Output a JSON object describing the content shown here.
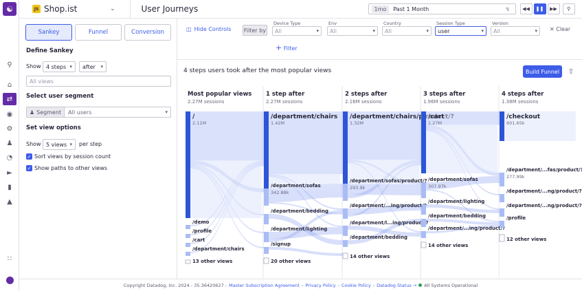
{
  "nav": {
    "logo_icon": "datadog-logo",
    "rail_icons": [
      "search-icon",
      "home-icon",
      "journeys-icon",
      "watchdog-icon",
      "settings-icon",
      "users-icon",
      "chart-pie-icon",
      "play-icon",
      "bar-chart-icon",
      "area-chart-icon",
      "grid-icon",
      "avatar"
    ]
  },
  "header": {
    "app_badge": "JS",
    "app_name": "Shop.ist",
    "page_title": "User Journeys",
    "time_chip": "1mo",
    "time_label": "Past 1 Month"
  },
  "left": {
    "tabs": [
      "Sankey",
      "Funnel",
      "Conversion"
    ],
    "define_title": "Define Sankey",
    "show_label": "Show",
    "steps_value": "4 steps",
    "direction_value": "after",
    "views_placeholder": "All views",
    "segment_title": "Select user segment",
    "segment_chip": "Segment",
    "segment_value": "All users",
    "options_title": "Set view options",
    "show2_label": "Show",
    "views_count": "5 views",
    "per_step": "per step",
    "sort_label": "Sort views by session count",
    "paths_label": "Show paths to other views"
  },
  "filters": {
    "hide_controls": "Hide Controls",
    "filter_by": "Filter by",
    "items": [
      {
        "label": "Device Type",
        "value": "All"
      },
      {
        "label": "Env",
        "value": "All"
      },
      {
        "label": "Country",
        "value": "All"
      },
      {
        "label": "Session Type",
        "value": "user"
      },
      {
        "label": "Version",
        "value": "All"
      }
    ],
    "clear": "Clear",
    "add_filter": "Filter"
  },
  "viz": {
    "headline": "4 steps users took after the most popular views",
    "build_funnel": "Build Funnel"
  },
  "sankey": {
    "columns": [
      {
        "title": "Most popular views",
        "sessions": "2.27M sessions"
      },
      {
        "title": "1 step after",
        "sessions": "2.27M sessions"
      },
      {
        "title": "2 steps after",
        "sessions": "2.16M sessions"
      },
      {
        "title": "3 steps after",
        "sessions": "1.96M sessions"
      },
      {
        "title": "4 steps after",
        "sessions": "1.38M sessions"
      }
    ],
    "nodes": [
      [
        {
          "label": "/",
          "count": "2.11M"
        },
        {
          "label": "/demo"
        },
        {
          "label": "/profile"
        },
        {
          "label": "/cart"
        },
        {
          "label": "/department/chairs"
        },
        {
          "label": "13 other views"
        }
      ],
      [
        {
          "label": "/department/chairs",
          "count": "1.42M"
        },
        {
          "label": "/department/sofas",
          "count": "342.88k"
        },
        {
          "label": "/department/bedding"
        },
        {
          "label": "/department/lighting"
        },
        {
          "label": "/signup"
        },
        {
          "label": "20 other views"
        }
      ],
      [
        {
          "label": "/department/chairs/p roduct/?",
          "count": "1.32M"
        },
        {
          "label": "/department/sofas/product/?",
          "count": "293.9k"
        },
        {
          "label": "/department/...ing/product/?"
        },
        {
          "label": "/department/l...ing/product/?"
        },
        {
          "label": "/department/bedding"
        },
        {
          "label": "14 other views"
        }
      ],
      [
        {
          "label": "/cart",
          "count": "1.27M"
        },
        {
          "label": "/department/sofas",
          "count": "307.97k"
        },
        {
          "label": "/department/lighting"
        },
        {
          "label": "/department/bedding"
        },
        {
          "label": "/department/...ing/product/?"
        },
        {
          "label": "14 other views"
        }
      ],
      [
        {
          "label": "/checkout",
          "count": "601.65k"
        },
        {
          "label": "/department/...fas/product/?",
          "count": "277.99k"
        },
        {
          "label": "/department/...ng/product/?"
        },
        {
          "label": "/department/...ng/product/?"
        },
        {
          "label": "/profile"
        },
        {
          "label": "12 other views"
        }
      ]
    ]
  },
  "footer": {
    "copyright": "Copyright Datadog, Inc. 2024 - 35.36420627 -",
    "links": [
      "Master Subscription Agreement",
      "Privacy Policy",
      "Cookie Policy",
      "Datadog Status →"
    ],
    "status": "All Systems Operational"
  }
}
